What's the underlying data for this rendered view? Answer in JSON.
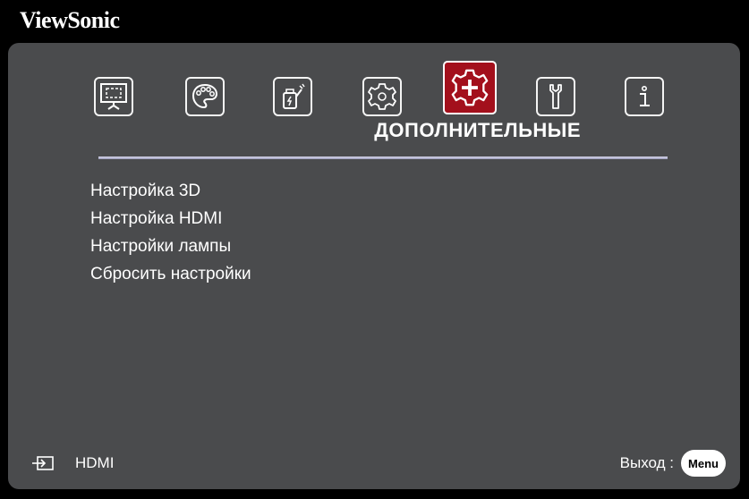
{
  "brand": "ViewSonic",
  "tabs": [
    {
      "icon": "screen-icon",
      "active": false
    },
    {
      "icon": "palette-icon",
      "active": false
    },
    {
      "icon": "power-plug-icon",
      "active": false
    },
    {
      "icon": "gear-icon",
      "active": false
    },
    {
      "icon": "advanced-gear-plus-icon",
      "active": true
    },
    {
      "icon": "wrench-icon",
      "active": false
    },
    {
      "icon": "info-icon",
      "active": false
    }
  ],
  "menu_title": "ДОПОЛНИТЕЛЬНЫЕ",
  "items": [
    {
      "label": "Настройка 3D"
    },
    {
      "label": "Настройка HDMI"
    },
    {
      "label": "Настройки лампы"
    },
    {
      "label": "Сбросить настройки"
    }
  ],
  "footer": {
    "source_icon": "input-source-icon",
    "source_label": "HDMI",
    "exit_label": "Выход :",
    "menu_button": "Menu"
  },
  "colors": {
    "panel": "#4a4b4d",
    "active_tab": "#a3101c",
    "text": "#ffffff",
    "divider": "#c8c8dc"
  }
}
